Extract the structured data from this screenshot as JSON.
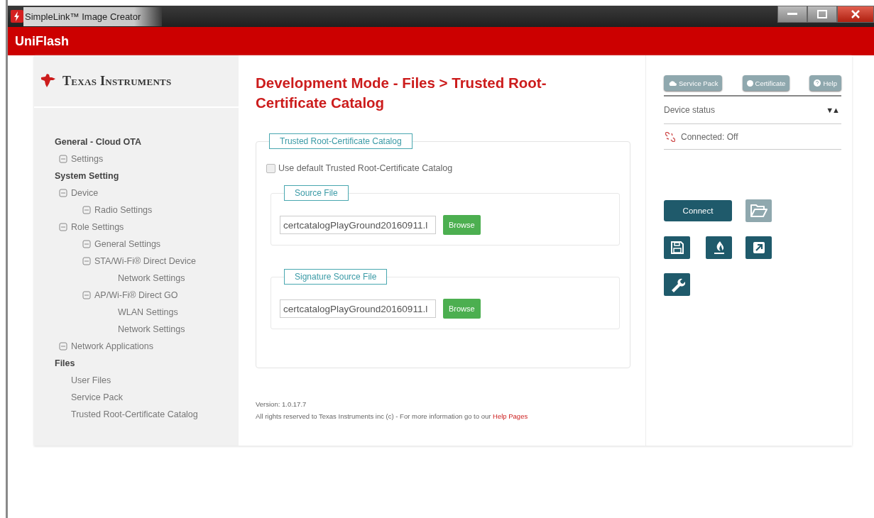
{
  "window": {
    "title": "SimpleLink™ Image Creator"
  },
  "app_bar": {
    "title": "UniFlash"
  },
  "sidebar": {
    "logo": "Texas Instruments",
    "items": [
      {
        "label": "General - Cloud OTA",
        "kind": "header",
        "children": [
          {
            "label": "Settings",
            "expanded": true
          }
        ]
      },
      {
        "label": "System Setting",
        "kind": "header",
        "children": [
          {
            "label": "Device",
            "expanded": true,
            "children": [
              {
                "label": "Radio Settings",
                "expanded": true
              }
            ]
          },
          {
            "label": "Role Settings",
            "expanded": true,
            "children": [
              {
                "label": "General Settings",
                "expanded": true
              },
              {
                "label": "STA/Wi-Fi® Direct Device",
                "expanded": true,
                "children": [
                  {
                    "label": "Network Settings"
                  }
                ]
              },
              {
                "label": "AP/Wi-Fi® Direct GO",
                "expanded": true,
                "children": [
                  {
                    "label": "WLAN Settings"
                  },
                  {
                    "label": "Network Settings"
                  }
                ]
              }
            ]
          },
          {
            "label": "Network Applications",
            "expanded": true
          }
        ]
      },
      {
        "label": "Files",
        "kind": "header",
        "children": [
          {
            "label": "User Files"
          },
          {
            "label": "Service Pack"
          },
          {
            "label": "Trusted Root-Certificate Catalog"
          }
        ]
      }
    ]
  },
  "main": {
    "title": "Development Mode - Files > Trusted Root-Certificate Catalog",
    "group": {
      "legend": "Trusted Root-Certificate Catalog",
      "checkbox": {
        "label": "Use default Trusted Root-Certificate Catalog",
        "checked": false
      },
      "files": [
        {
          "legend": "Source File",
          "value": "certcatalogPlayGround20160911.l",
          "button": "Browse"
        },
        {
          "legend": "Signature Source File",
          "value": "certcatalogPlayGround20160911.l",
          "button": "Browse"
        }
      ]
    },
    "footer": {
      "version": "Version: 1.0.17.7",
      "rights": "All rights reserved to Texas Instruments inc (c) - For more information go to our",
      "link": "Help Pages"
    }
  },
  "right_panel": {
    "top_buttons": [
      {
        "label": "Service Pack",
        "kind": "cloud"
      },
      {
        "label": "Certificate",
        "kind": "dot"
      },
      {
        "label": "Help",
        "kind": "help"
      }
    ],
    "device_status": {
      "label": "Device status",
      "toggle": "▼▲"
    },
    "connection": {
      "label": "Connected: Off"
    },
    "connect_button": "Connect",
    "tools": [
      {
        "kind": "folder",
        "disabled": true
      },
      {
        "kind": "save",
        "disabled": false
      },
      {
        "kind": "flame",
        "disabled": false
      },
      {
        "kind": "external",
        "disabled": false
      },
      {
        "kind": "wrench",
        "disabled": false
      }
    ]
  }
}
